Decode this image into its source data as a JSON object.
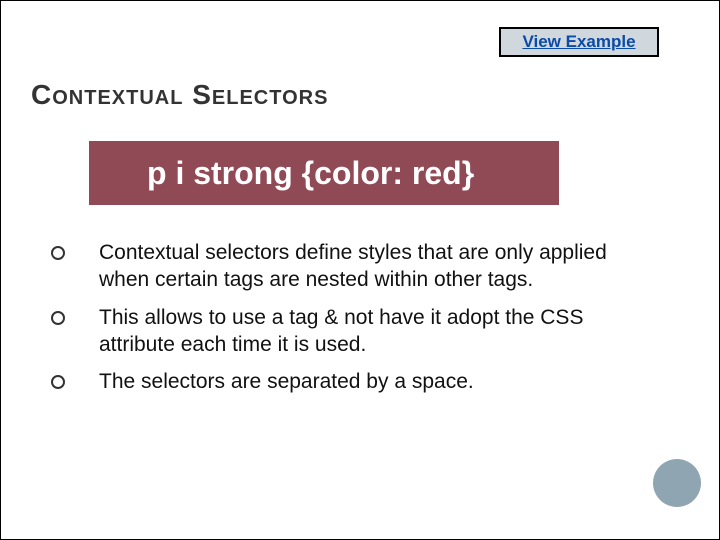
{
  "link": {
    "label": "View Example"
  },
  "title": "Contextual Selectors",
  "code": "p i strong {color: red}",
  "bullets": [
    "Contextual selectors define styles that are only applied when certain tags are nested within other tags.",
    "This allows to use a tag & not have it adopt the CSS attribute each time it is used.",
    "The selectors are separated by a space."
  ]
}
